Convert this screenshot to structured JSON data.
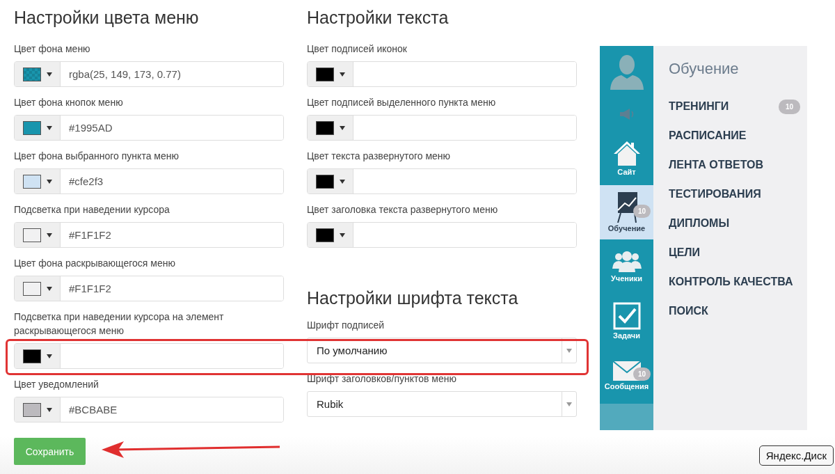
{
  "color_settings": {
    "title": "Настройки цвета меню",
    "fields": [
      {
        "label": "Цвет фона меню",
        "kind": "transparent",
        "color": "#1995ad",
        "value": "rgba(25, 149, 173, 0.77)"
      },
      {
        "label": "Цвет фона кнопок меню",
        "color": "#1995ad",
        "value": "#1995AD"
      },
      {
        "label": "Цвет фона выбранного пункта меню",
        "color": "#cfe2f3",
        "value": "#cfe2f3"
      },
      {
        "label": "Подсветка при наведении курсора",
        "color": "#f1f1f2",
        "value": "#F1F1F2"
      },
      {
        "label": "Цвет фона раскрывающегося меню",
        "color": "#f1f1f2",
        "value": "#F1F1F2"
      },
      {
        "label": "Подсветка при наведении курсора на элемент раскрывающегося меню",
        "color": "#000000"
      },
      {
        "label": "Цвет уведомлений",
        "color": "#bcbabe",
        "value": "#BCBABE"
      }
    ]
  },
  "text_settings": {
    "title": "Настройки текста",
    "fields": [
      {
        "label": "Цвет подписей иконок",
        "color": "#000000"
      },
      {
        "label": "Цвет подписей выделенного пункта меню",
        "color": "#000000"
      },
      {
        "label": "Цвет текста развернутого меню",
        "color": "#000000"
      },
      {
        "label": "Цвет заголовка текста развернутого меню",
        "color": "#000000"
      }
    ]
  },
  "font_settings": {
    "title": "Настройки шрифта текста",
    "selects": [
      {
        "label": "Шрифт подписей",
        "value": "По умолчанию"
      },
      {
        "label": "Шрифт заголовков/пунктов меню",
        "value": "Rubik"
      }
    ]
  },
  "save_button": "Сохранить",
  "annotations": {
    "frame": true,
    "arrow": true
  },
  "preview": {
    "icons": [
      {
        "kind": "avatar",
        "selected": false
      },
      {
        "kind": "speaker",
        "selected": false
      },
      {
        "kind": "home",
        "label": "Сайт",
        "selected": false
      },
      {
        "kind": "chart",
        "label": "Обучение",
        "badge": "10",
        "selected": true
      },
      {
        "kind": "people",
        "label": "Ученики",
        "selected": false
      },
      {
        "kind": "tasks",
        "label": "Задачи",
        "selected": false
      },
      {
        "kind": "mail",
        "label": "Сообщения",
        "badge": "10",
        "selected": false
      }
    ],
    "menu_title": "Обучение",
    "menu_items": [
      {
        "label": "ТРЕНИНГИ",
        "badge": "10"
      },
      {
        "label": "РАСПИСАНИЕ"
      },
      {
        "label": "ЛЕНТА ОТВЕТОВ"
      },
      {
        "label": "ТЕСТИРОВАНИЯ"
      },
      {
        "label": "ДИПЛОМЫ"
      },
      {
        "label": "ЦЕЛИ"
      },
      {
        "label": "КОНТРОЛЬ КАЧЕСТВА"
      },
      {
        "label": "ПОИСК"
      }
    ]
  },
  "tooltip": "Яндекс.Диск"
}
